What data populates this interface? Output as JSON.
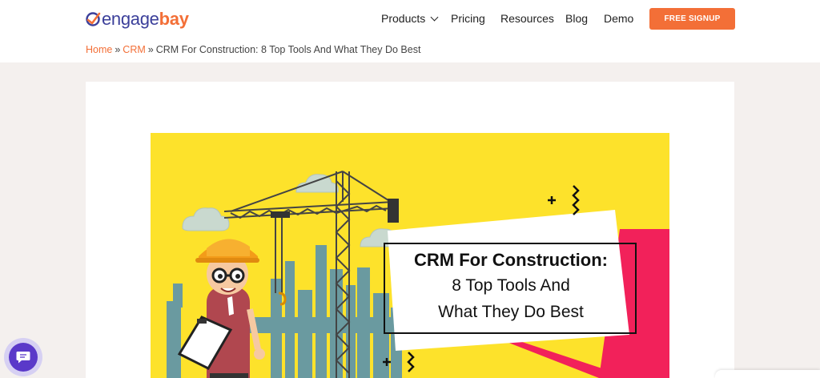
{
  "brand": {
    "name_part1": "engage",
    "name_part2": "bay",
    "accent": "#f36f37",
    "primary": "#3b3f9a"
  },
  "nav": {
    "products": "Products",
    "pricing": "Pricing",
    "resources": "Resources",
    "blog": "Blog",
    "demo": "Demo",
    "signup": "FREE SIGNUP"
  },
  "breadcrumb": {
    "home": "Home",
    "separator": "»",
    "crm": "CRM",
    "current": "CRM For Construction: 8 Top Tools And What They Do Best"
  },
  "hero": {
    "title_line1": "CRM For Construction:",
    "title_line2": "8 Top Tools And",
    "title_line3": "What They Do Best",
    "background_color": "#fde22b"
  },
  "chat": {
    "icon": "chat-bubble-icon"
  }
}
